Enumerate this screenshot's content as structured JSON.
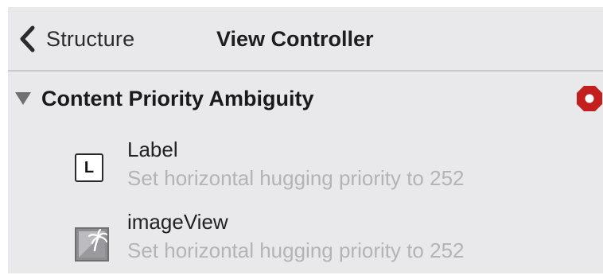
{
  "nav": {
    "back_label": "Structure",
    "title": "View Controller"
  },
  "section": {
    "title": "Content Priority Ambiguity",
    "expanded": true,
    "status_icon": "error-icon",
    "status_color": "#c41f1f"
  },
  "issues": [
    {
      "name": "Label",
      "icon": "label-icon",
      "icon_letter": "L",
      "detail": "Set horizontal hugging priority to 252"
    },
    {
      "name": "imageView",
      "icon": "image-view-icon",
      "detail": "Set horizontal hugging priority to 252"
    }
  ]
}
